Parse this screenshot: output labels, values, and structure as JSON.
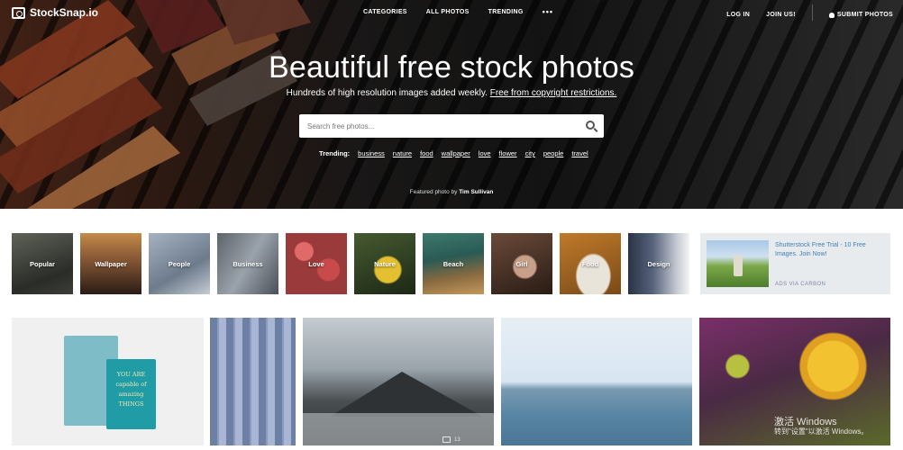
{
  "nav": {
    "logo": "StockSnap.io",
    "links": [
      "CATEGORIES",
      "ALL PHOTOS",
      "TRENDING"
    ],
    "more": "•••",
    "login": "LOG IN",
    "join": "JOIN US!",
    "submit": "SUBMIT PHOTOS"
  },
  "hero": {
    "title": "Beautiful free stock photos",
    "subtitle": "Hundreds of high resolution images added weekly.",
    "subtitle_link": "Free from copyright restrictions.",
    "search_placeholder": "Search free photos...",
    "trending_label": "Trending:",
    "trending": [
      "business",
      "nature",
      "food",
      "wallpaper",
      "love",
      "flower",
      "city",
      "people",
      "travel"
    ],
    "featured_prefix": "Featured photo by",
    "featured_author": "Tim Sullivan"
  },
  "categories": [
    "Popular",
    "Wallpaper",
    "People",
    "Business",
    "Love",
    "Nature",
    "Beach",
    "Girl",
    "Food",
    "Design"
  ],
  "ad": {
    "text": "Shutterstock Free Trial - 10 Free Images. Join Now!",
    "via": "ADS VIA CARBON"
  },
  "photos": {
    "book_text": "YOU ARE capable of amazing THINGS",
    "photo_count_label": "13"
  },
  "watermark": {
    "line1": "激活 Windows",
    "line2": "转到\"设置\"以激活 Windows。"
  }
}
